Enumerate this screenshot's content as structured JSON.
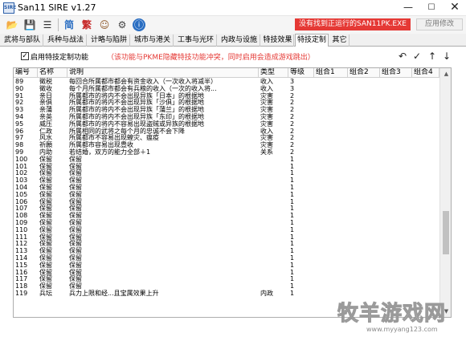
{
  "window": {
    "title": "San11 SIRE v1.27",
    "app_icon_text": "SIRE"
  },
  "toolbar": {
    "buttons": [
      {
        "name": "open-folder-icon",
        "glyph": "📂"
      },
      {
        "name": "save-icon",
        "glyph": "💾"
      },
      {
        "name": "list-icon",
        "glyph": "☰"
      },
      {
        "name": "simplified-button",
        "glyph": "简"
      },
      {
        "name": "traditional-button",
        "glyph": "繁"
      },
      {
        "name": "character-icon",
        "glyph": "☺"
      },
      {
        "name": "settings-icon",
        "glyph": "⚙"
      },
      {
        "name": "info-icon",
        "glyph": "ⓘ"
      }
    ],
    "warning": "没有找到正运行的SAN11PK.EXE",
    "apply_label": "应用修改",
    "colors": {
      "warning_bg": "#e53935",
      "warning_fg": "#ffffff"
    }
  },
  "tabs": [
    "武将与部队",
    "兵种与战法",
    "计略与陷阱",
    "城市与港关",
    "工事与光环",
    "内政与设施",
    "特技效果",
    "特技定制",
    "其它"
  ],
  "active_tab": "特技定制",
  "options": {
    "enable_label": "启用特技定制功能",
    "enable_checked": true,
    "warning": "（该功能与PKME隐藏特技功能冲突，同时启用会造成游戏跳出）",
    "warning_color": "#e53935",
    "tool_icons": [
      "undo-icon",
      "check-icon",
      "up-arrow-icon",
      "down-arrow-icon"
    ]
  },
  "table": {
    "columns": [
      "编号",
      "名称",
      "说明",
      "类型",
      "等级",
      "组合1",
      "组合2",
      "组合3",
      "组合4"
    ],
    "rows": [
      [
        "89",
        "徵税",
        "每回合所属都市都会有资金收入（一次收入将减半）",
        "收入",
        "3"
      ],
      [
        "90",
        "徵收",
        "每个月所属都市都会有兵粮的收入（一次的收入将...",
        "收入",
        "3"
      ],
      [
        "91",
        "亲日",
        "所属都市的将内不会出现异族「日本」的根据地",
        "灾害",
        "2"
      ],
      [
        "92",
        "亲俱",
        "所属都市的将内不会出现异族「沙俱」的根据地",
        "灾害",
        "2"
      ],
      [
        "93",
        "亲蒲",
        "所属都市的将内不会出现异族「蒲兰」的根据地",
        "灾害",
        "2"
      ],
      [
        "94",
        "亲英",
        "所属都市的将内不会出现异族「东印」的根据地",
        "灾害",
        "2"
      ],
      [
        "95",
        "威压",
        "所属都市的将内不容易出现盗贼或异族的根据地",
        "灾害",
        "2"
      ],
      [
        "96",
        "仁政",
        "所属相同的武将之每个月的忠诚不会下降",
        "收入",
        "2"
      ],
      [
        "97",
        "风水",
        "所属都市不容易出现蝗灾、瘟疫",
        "灾害",
        "2"
      ],
      [
        "98",
        "祈願",
        "所属都市容易出现豊收",
        "灾害",
        "2"
      ],
      [
        "99",
        "内助",
        "若结婚，双方的能力全部＋1",
        "关系",
        "2"
      ],
      [
        "100",
        "保留",
        "保留",
        "",
        "1"
      ],
      [
        "101",
        "保留",
        "保留",
        "",
        "1"
      ],
      [
        "102",
        "保留",
        "保留",
        "",
        "1"
      ],
      [
        "103",
        "保留",
        "保留",
        "",
        "1"
      ],
      [
        "104",
        "保留",
        "保留",
        "",
        "1"
      ],
      [
        "105",
        "保留",
        "保留",
        "",
        "1"
      ],
      [
        "106",
        "保留",
        "保留",
        "",
        "1"
      ],
      [
        "107",
        "保留",
        "保留",
        "",
        "1"
      ],
      [
        "108",
        "保留",
        "保留",
        "",
        "1"
      ],
      [
        "109",
        "保留",
        "保留",
        "",
        "1"
      ],
      [
        "110",
        "保留",
        "保留",
        "",
        "1"
      ],
      [
        "111",
        "保留",
        "保留",
        "",
        "1"
      ],
      [
        "112",
        "保留",
        "保留",
        "",
        "1"
      ],
      [
        "113",
        "保留",
        "保留",
        "",
        "1"
      ],
      [
        "114",
        "保留",
        "保留",
        "",
        "1"
      ],
      [
        "115",
        "保留",
        "保留",
        "",
        "1"
      ],
      [
        "116",
        "保留",
        "保留",
        "",
        "1"
      ],
      [
        "117",
        "保留",
        "保留",
        "",
        "1"
      ],
      [
        "118",
        "保留",
        "保留",
        "",
        "1"
      ],
      [
        "119",
        "兵坛",
        "兵力上限和经...且宝属效果上升",
        "内政",
        "1"
      ]
    ]
  },
  "watermark": {
    "main": "牧羊游戏网",
    "url": "www.myyang123.com"
  }
}
